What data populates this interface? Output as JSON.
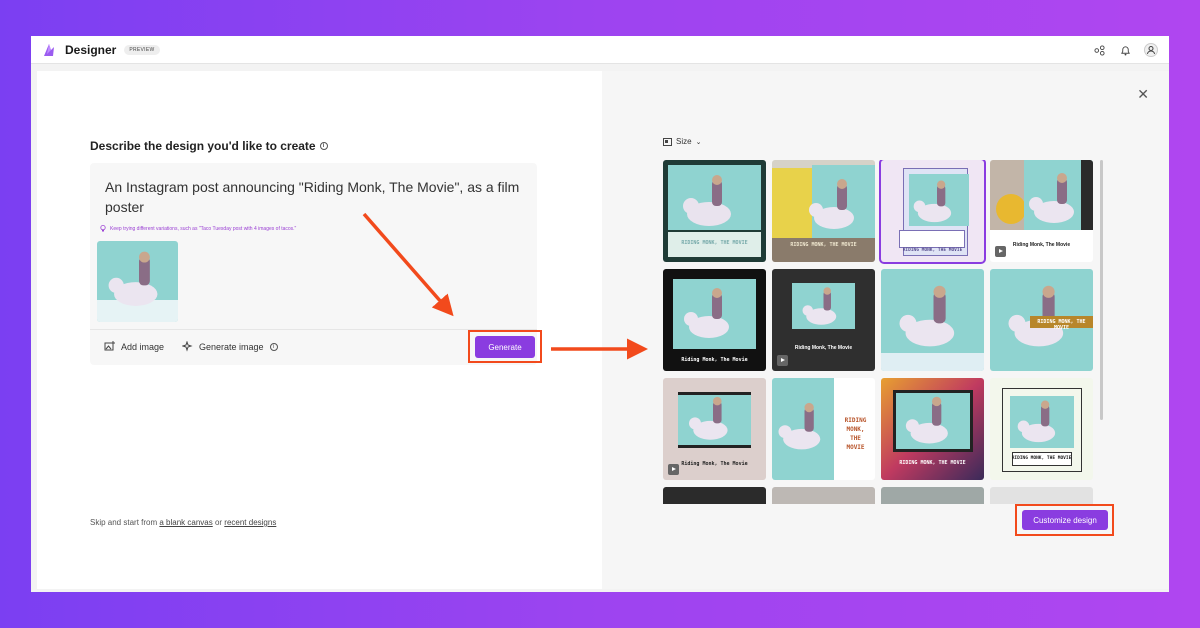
{
  "app": {
    "name": "Designer",
    "badge": "PREVIEW"
  },
  "left": {
    "heading": "Describe the design you'd like to create",
    "prompt": "An Instagram post announcing \"Riding Monk, The Movie\", as a film poster",
    "hint": "Keep trying different variations, such as \"Taco Tuesday post with 4 images of tacos.\"",
    "add_image": "Add image",
    "generate_image": "Generate image",
    "generate_button": "Generate",
    "skip_prefix": "Skip and start from ",
    "blank_canvas": "a blank canvas",
    "or": " or ",
    "recent_designs": "recent designs"
  },
  "right": {
    "size_label": "Size",
    "customize_button": "Customize design",
    "cards": [
      {
        "caption": "RIDING MONK, THE MOVIE"
      },
      {
        "caption": "RIDING MONK, THE MOVIE"
      },
      {
        "caption": "RIDING MONK, THE MOVIE"
      },
      {
        "caption": "Riding Monk, The Movie"
      },
      {
        "caption": "Riding Monk, The Movie"
      },
      {
        "caption": "Riding Monk, The Movie"
      },
      {
        "caption": ""
      },
      {
        "caption": "RIDING MONK, THE MOVIE"
      },
      {
        "caption": "Riding Monk, The Movie"
      },
      {
        "caption": "RIDING MONK, THE MOVIE"
      },
      {
        "caption": "RIDING MONK, THE MOVIE"
      },
      {
        "caption": "RIDING MONK, THE MOVIE"
      }
    ]
  },
  "colors": {
    "accent": "#8a3ce0",
    "highlight": "#f24a1c"
  }
}
